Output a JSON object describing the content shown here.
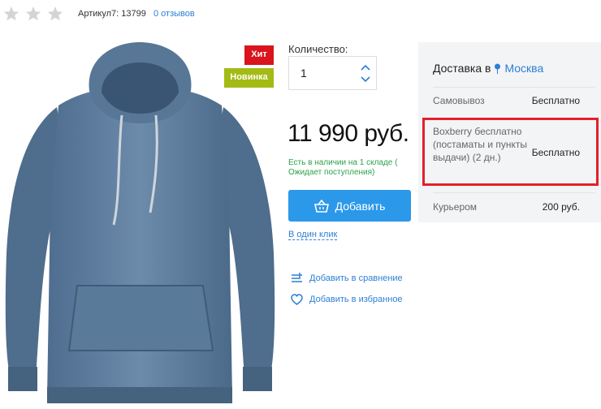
{
  "rating": {
    "stars": 0,
    "max": 5
  },
  "article": "Артикул7: 13799",
  "reviews_link": "0 отзывов",
  "badges": {
    "hit": "Хит",
    "new": "Новинка"
  },
  "quantity": {
    "label": "Количество:",
    "value": "1"
  },
  "price": "11 990 руб.",
  "stock_status": "Есть в наличии на 1 складе ( Ожидает поступления)",
  "buttons": {
    "add": "Добавить",
    "one_click": "В один клик"
  },
  "actions": {
    "compare": "Добавить в сравнение",
    "favorite": "Добавить в избранное"
  },
  "delivery": {
    "title": "Доставка в",
    "city": "Москва",
    "options": [
      {
        "label": "Самовывоз",
        "value": "Бесплатно"
      },
      {
        "label": "Boxberry бесплатно (постаматы и пункты выдачи) (2 дн.)",
        "value": "Бесплатно"
      },
      {
        "label": "Курьером",
        "value": "200 руб."
      }
    ]
  },
  "colors": {
    "accent": "#2b98ea",
    "link": "#2c7fd6",
    "hit": "#d9141c",
    "new": "#a3bb14",
    "stock": "#2ca24a",
    "highlight": "#e3202a"
  }
}
